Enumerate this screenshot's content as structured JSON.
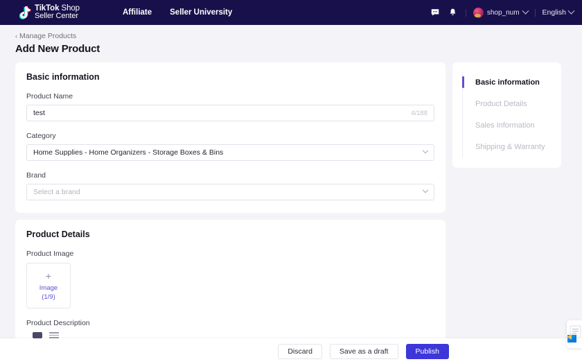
{
  "header": {
    "logo": {
      "icon": "tiktok-note-icon",
      "line1_bold": "TikTok",
      "line1_thin": " Shop",
      "line2": "Seller Center"
    },
    "nav": [
      {
        "label": "Affiliate",
        "name": "nav-affiliate"
      },
      {
        "label": "Seller University",
        "name": "nav-seller-university"
      }
    ],
    "message_icon": "message-icon",
    "bell_icon": "bell-icon",
    "account": {
      "name": "shop_num",
      "avatar": "user-avatar"
    },
    "language": {
      "label": "English"
    }
  },
  "breadcrumb": {
    "arrow": "‹",
    "label": "Manage Products"
  },
  "page_title": "Add New Product",
  "basic_information": {
    "card_title": "Basic information",
    "product_name": {
      "label": "Product Name",
      "value": "test",
      "counter": "4/188"
    },
    "category": {
      "label": "Category",
      "value": "Home Supplies - Home Organizers - Storage Boxes & Bins"
    },
    "brand": {
      "label": "Brand",
      "placeholder": "Select a brand"
    }
  },
  "product_details": {
    "card_title": "Product Details",
    "product_image": {
      "label": "Product Image",
      "plus": "+",
      "line1": "Image",
      "line2": "(1/9)"
    },
    "product_description": {
      "label": "Product Description"
    }
  },
  "sidebar": {
    "items": [
      {
        "label": "Basic information",
        "name": "sidebar-item-basic-information",
        "active": true
      },
      {
        "label": "Product Details",
        "name": "sidebar-item-product-details",
        "active": false
      },
      {
        "label": "Sales Information",
        "name": "sidebar-item-sales-information",
        "active": false
      },
      {
        "label": "Shipping & Warranty",
        "name": "sidebar-item-shipping-warranty",
        "active": false
      }
    ]
  },
  "bottom_bar": {
    "discard": "Discard",
    "save_draft": "Save as a draft",
    "publish": "Publish"
  },
  "colors": {
    "header_bg": "#18104a",
    "accent": "#5b4fd6",
    "primary_button": "#3d36d8",
    "page_bg": "#f4f4f8"
  }
}
